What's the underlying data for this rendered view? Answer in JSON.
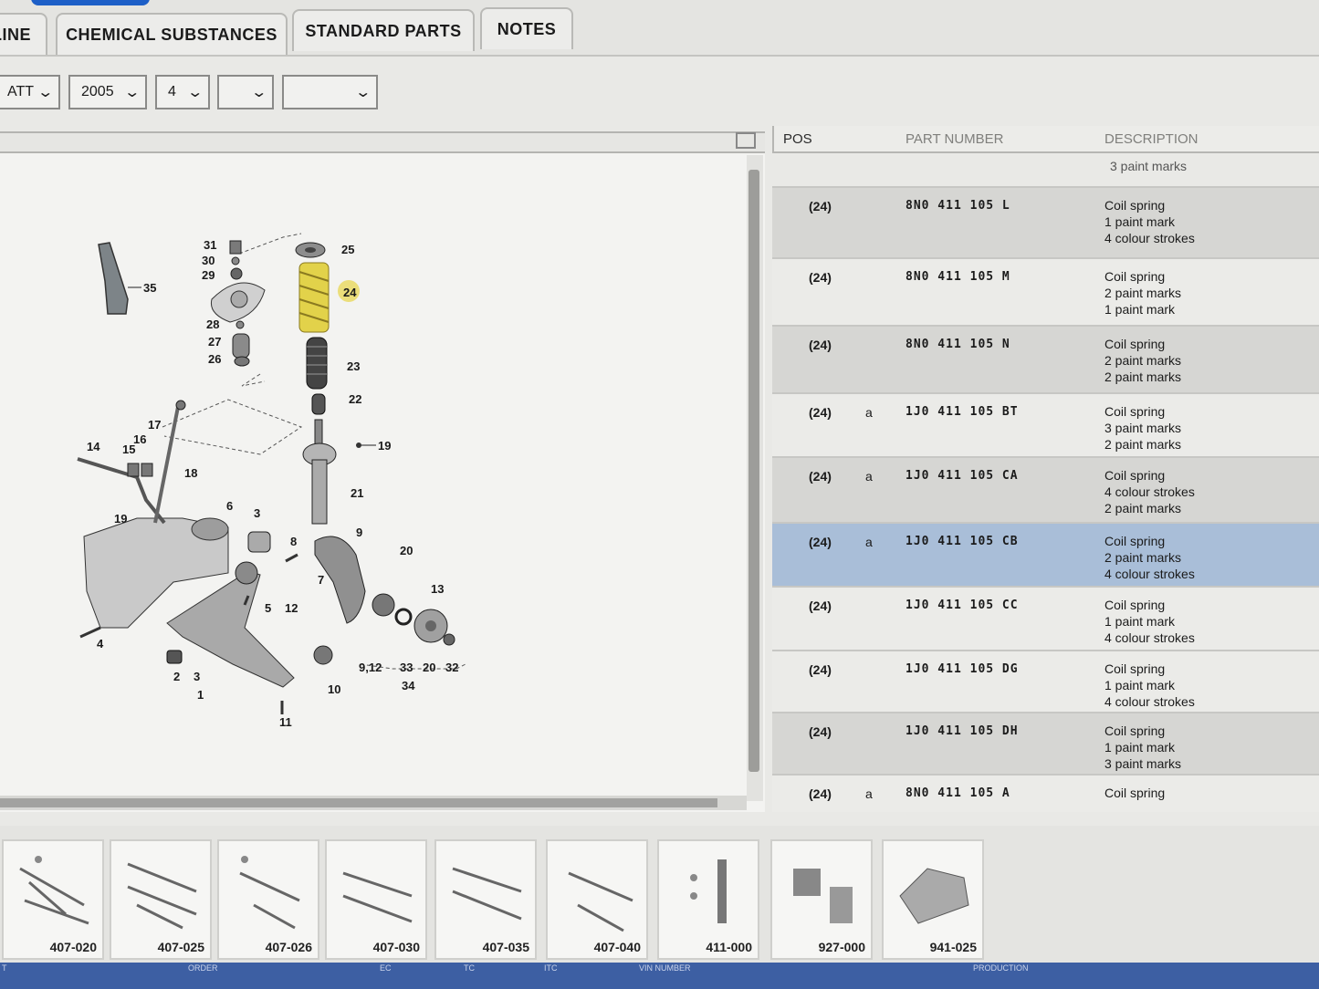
{
  "tabs": [
    {
      "label": "LINE"
    },
    {
      "label": "CHEMICAL SUBSTANCES"
    },
    {
      "label": "STANDARD PARTS"
    },
    {
      "label": "NOTES"
    }
  ],
  "filters": {
    "f1": "ATT",
    "f2": "2005",
    "f3": "4",
    "f4": "",
    "f5": ""
  },
  "diagram": {
    "labels": [
      "35",
      "31",
      "30",
      "29",
      "28",
      "27",
      "26",
      "25",
      "24",
      "23",
      "22",
      "19",
      "21",
      "9",
      "20",
      "17",
      "16",
      "15",
      "14",
      "18",
      "6",
      "3",
      "19",
      "8",
      "7",
      "13",
      "5",
      "12",
      "4",
      "2",
      "3",
      "1",
      "11",
      "10",
      "9,12",
      "33",
      "20",
      "32",
      "34"
    ]
  },
  "table": {
    "headers": {
      "pos": "POS",
      "part": "PART NUMBER",
      "desc": "DESCRIPTION"
    },
    "overflow": "3 paint marks",
    "rows": [
      {
        "pos": "(24)",
        "mark": "",
        "part": "8N0 411 105 L",
        "desc": [
          "Coil spring",
          "1 paint mark",
          "4 colour strokes"
        ]
      },
      {
        "pos": "(24)",
        "mark": "",
        "part": "8N0 411 105 M",
        "desc": [
          "Coil spring",
          "2 paint marks",
          "1 paint mark"
        ]
      },
      {
        "pos": "(24)",
        "mark": "",
        "part": "8N0 411 105 N",
        "desc": [
          "Coil spring",
          "2 paint marks",
          "2 paint marks"
        ]
      },
      {
        "pos": "(24)",
        "mark": "a",
        "part": "1J0 411 105 BT",
        "desc": [
          "Coil spring",
          "3 paint marks",
          "2 paint marks"
        ]
      },
      {
        "pos": "(24)",
        "mark": "a",
        "part": "1J0 411 105 CA",
        "desc": [
          "Coil spring",
          "4 colour strokes",
          "2 paint marks"
        ]
      },
      {
        "pos": "(24)",
        "mark": "a",
        "part": "1J0 411 105 CB",
        "desc": [
          "Coil spring",
          "2 paint marks",
          "4 colour strokes"
        ]
      },
      {
        "pos": "(24)",
        "mark": "",
        "part": "1J0 411 105 CC",
        "desc": [
          "Coil spring",
          "1 paint mark",
          "4 colour strokes"
        ]
      },
      {
        "pos": "(24)",
        "mark": "",
        "part": "1J0 411 105 DG",
        "desc": [
          "Coil spring",
          "1 paint mark",
          "4 colour strokes"
        ]
      },
      {
        "pos": "(24)",
        "mark": "",
        "part": "1J0 411 105 DH",
        "desc": [
          "Coil spring",
          "1 paint mark",
          "3 paint marks"
        ]
      },
      {
        "pos": "(24)",
        "mark": "a",
        "part": "8N0 411 105 A",
        "desc": [
          "Coil spring"
        ]
      }
    ]
  },
  "thumbnails": [
    "407-020",
    "407-025",
    "407-026",
    "407-030",
    "407-035",
    "407-040",
    "411-000",
    "927-000",
    "941-025"
  ],
  "bottom_labels": [
    "T",
    "ORDER",
    "EC",
    "TC",
    "ITC",
    "VIN NUMBER",
    "PRODUCTION"
  ],
  "colors": {
    "accent": "#1d5fc7",
    "selected_row": "#a9bed8",
    "highlight_part": "#e2d24a"
  }
}
